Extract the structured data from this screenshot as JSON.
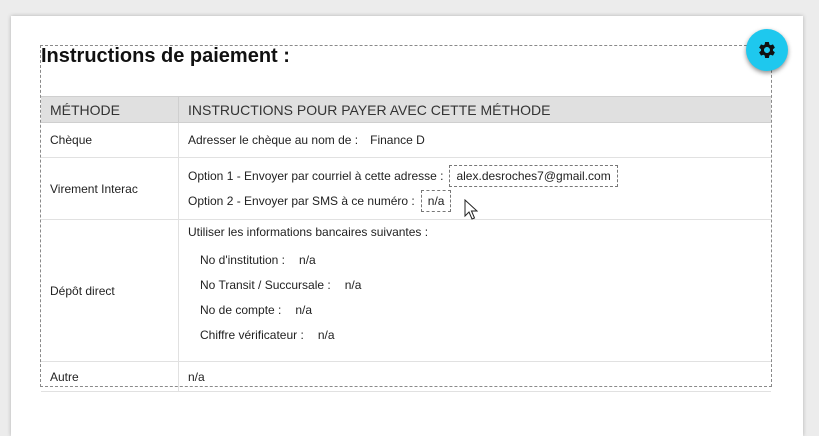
{
  "page": {
    "title": "Instructions de paiement :",
    "settings_icon": "gear-icon",
    "accent_color": "#1ec8ee"
  },
  "table": {
    "headers": [
      "MÉTHODE",
      "INSTRUCTIONS POUR PAYER AVEC CETTE MÉTHODE"
    ],
    "cheque": {
      "method": "Chèque",
      "label": "Adresser le chèque au nom de :",
      "value": "Finance D"
    },
    "interac": {
      "method": "Virement Interac",
      "option1_label": "Option 1 - Envoyer par courriel à cette adresse  :",
      "option1_value": "alex.desroches7@gmail.com",
      "option2_label": "Option 2 - Envoyer par SMS à ce numéro :",
      "option2_value": "n/a"
    },
    "depot": {
      "method": "Dépôt direct",
      "intro": "Utiliser les informations bancaires suivantes :",
      "fields": [
        {
          "label": "No d'institution :",
          "value": "n/a"
        },
        {
          "label": "No Transit / Succursale :",
          "value": "n/a"
        },
        {
          "label": "No de compte :",
          "value": "n/a"
        },
        {
          "label": "Chiffre vérificateur :",
          "value": "n/a"
        }
      ]
    },
    "autre": {
      "method": "Autre",
      "value": "n/a"
    }
  }
}
